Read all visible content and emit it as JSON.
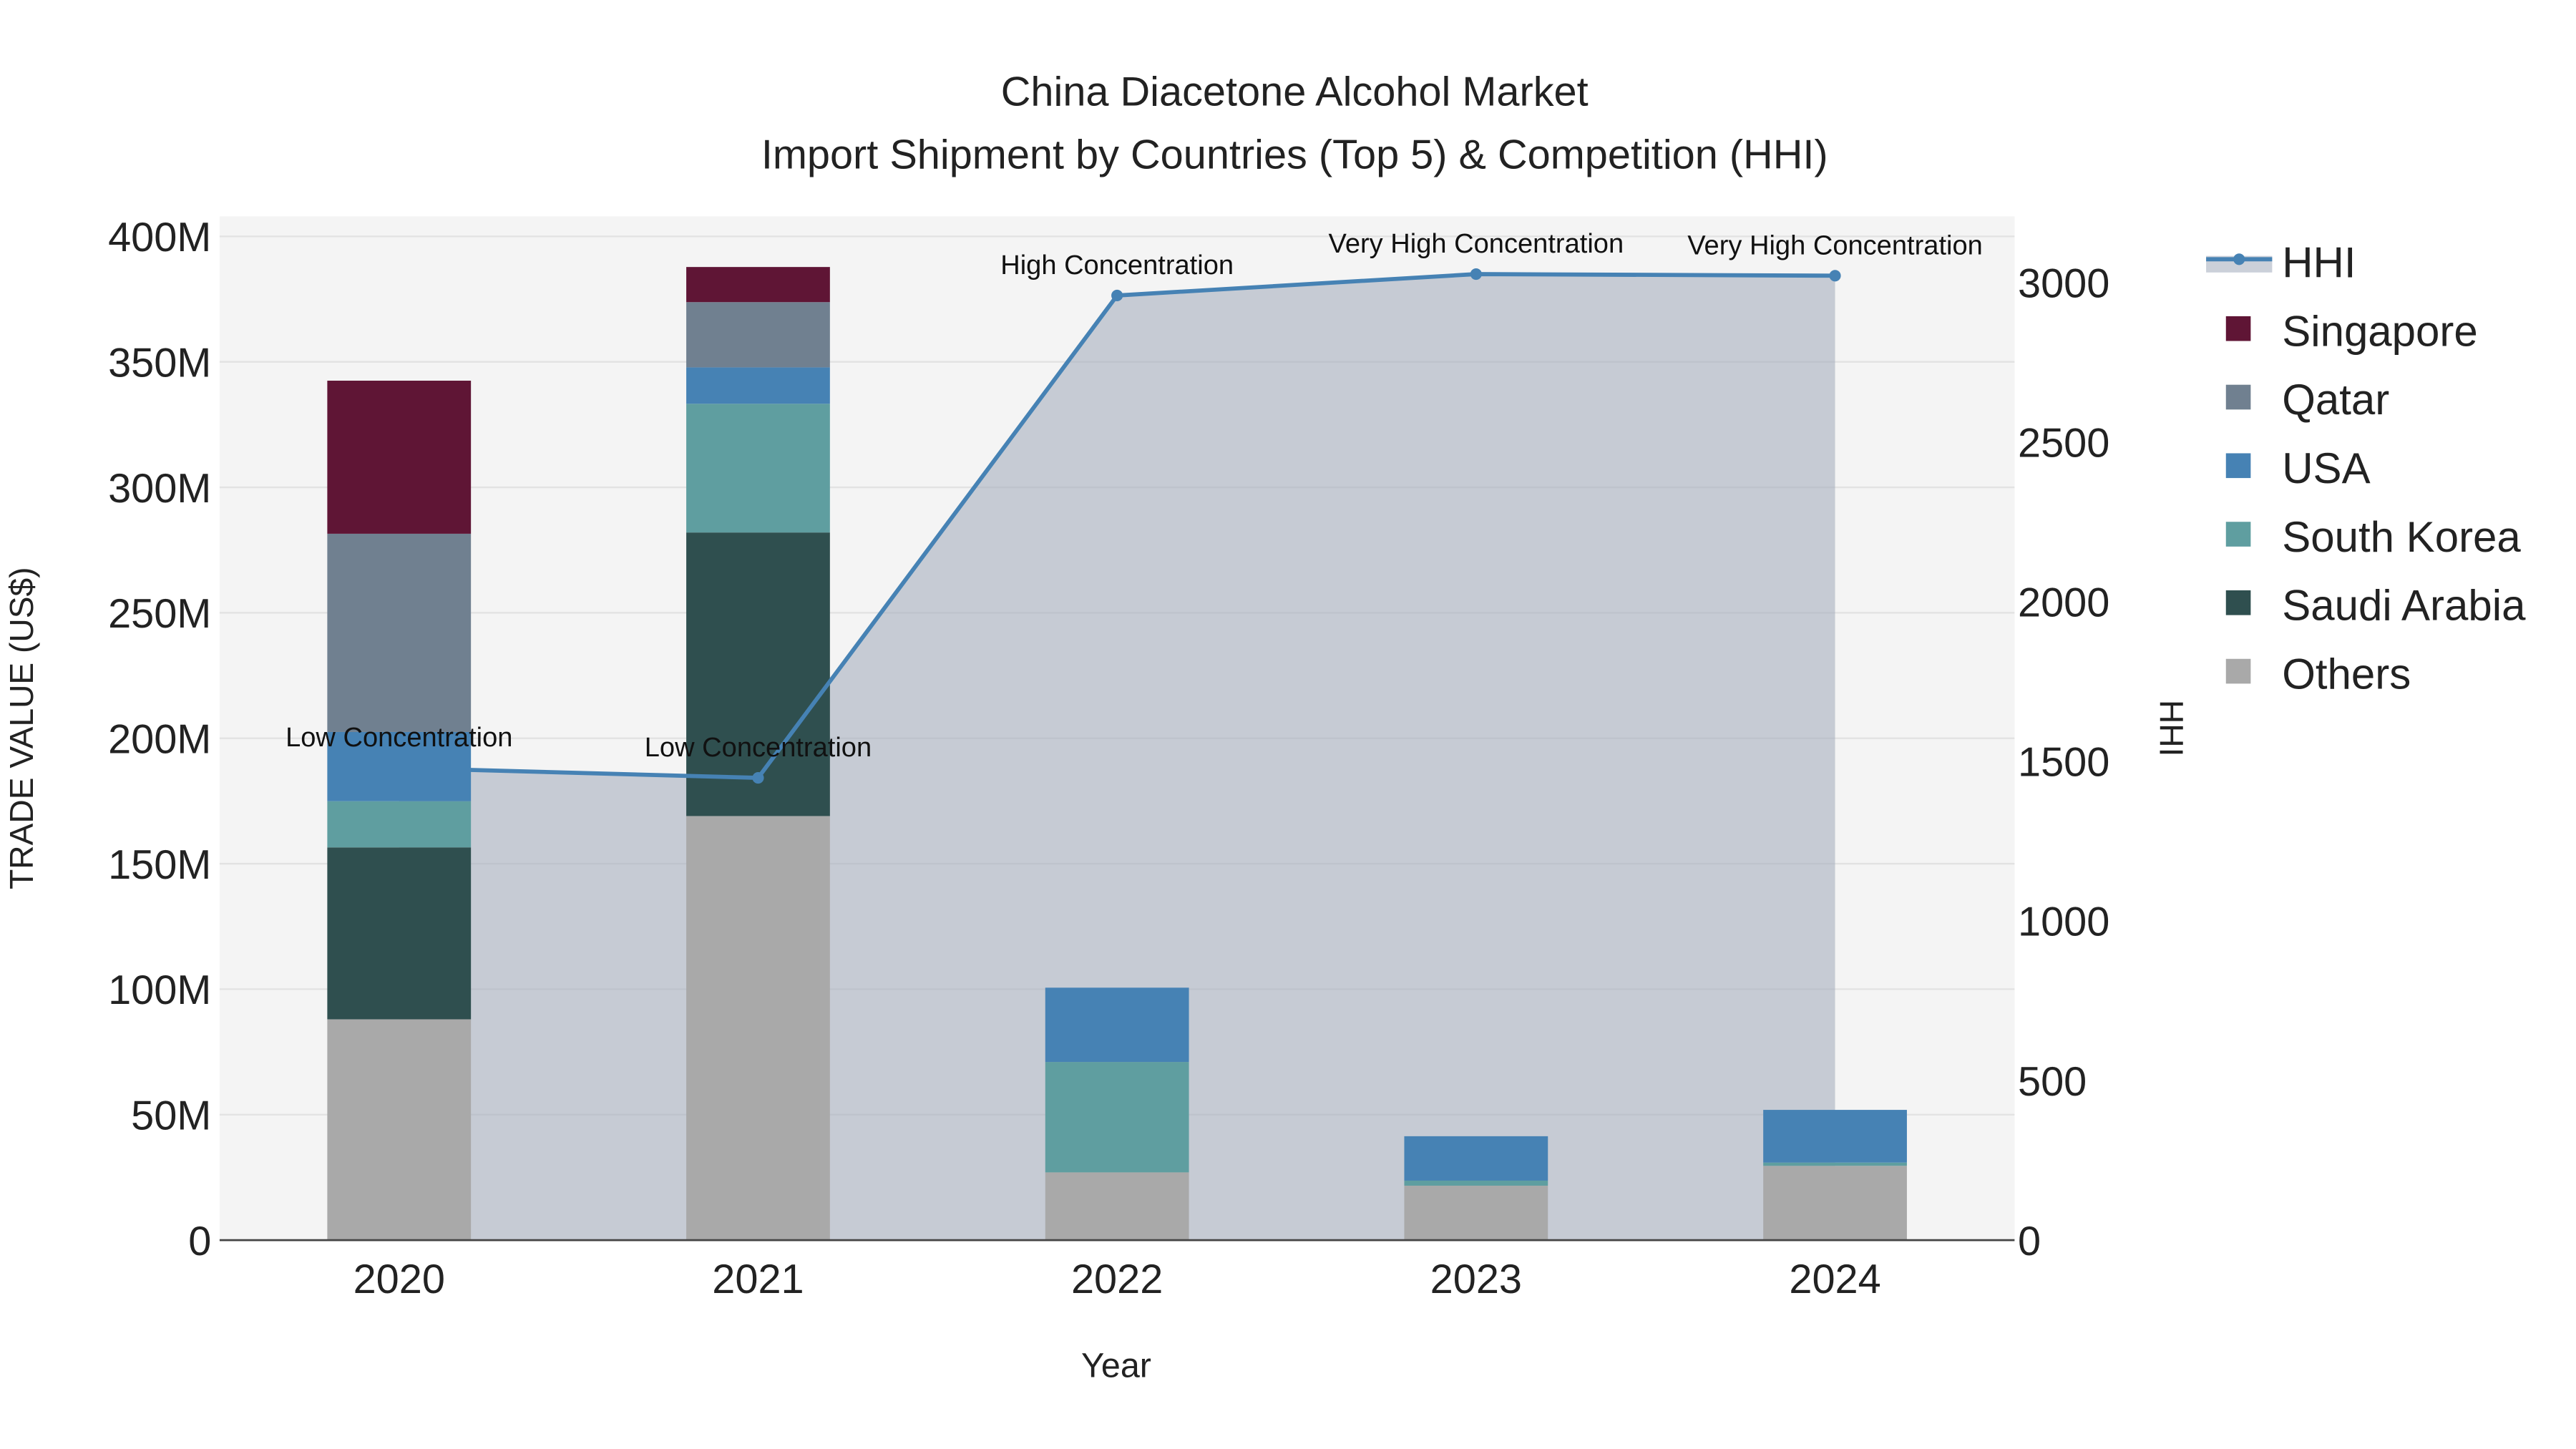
{
  "chart_data": {
    "type": "bar",
    "barmode": "stack",
    "title": "China Diacetone Alcohol Market",
    "subtitle": "Import Shipment by Countries (Top 5) & Competition (HHI)",
    "xlabel": "Year",
    "ylabel": "TRADE VALUE (US$)",
    "y2label": "HHI",
    "categories": [
      "2020",
      "2021",
      "2022",
      "2023",
      "2024"
    ],
    "ylim": [
      0,
      408
    ],
    "y_unit": "M",
    "y_ticks": [
      0,
      50,
      100,
      150,
      200,
      250,
      300,
      350,
      400
    ],
    "y_tick_labels": [
      "0",
      "50M",
      "100M",
      "150M",
      "200M",
      "250M",
      "300M",
      "350M",
      "400M"
    ],
    "y2lim": [
      0,
      3207
    ],
    "y2_ticks": [
      0,
      500,
      1000,
      1500,
      2000,
      2500,
      3000
    ],
    "y2_tick_labels": [
      "0",
      "500",
      "1000",
      "1500",
      "2000",
      "2500",
      "3000"
    ],
    "series": [
      {
        "name": "Others",
        "color": "#a9a9a9",
        "values": [
          88,
          169,
          27,
          21.7,
          29.6
        ]
      },
      {
        "name": "Saudi Arabia",
        "color": "#2f4f4f",
        "values": [
          68.5,
          113,
          0,
          0,
          0
        ]
      },
      {
        "name": "South Korea",
        "color": "#5f9ea0",
        "values": [
          18.4,
          51.3,
          44,
          2,
          1.3
        ]
      },
      {
        "name": "USA",
        "color": "#4682b4",
        "values": [
          27.6,
          14.5,
          29.6,
          17.7,
          21
        ]
      },
      {
        "name": "Qatar",
        "color": "#708090",
        "values": [
          79,
          26,
          0,
          0,
          0
        ]
      },
      {
        "name": "Singapore",
        "color": "#5f1535",
        "values": [
          61,
          14,
          0,
          0,
          0
        ]
      }
    ],
    "line": {
      "name": "HHI",
      "color": "#4682b4",
      "values": [
        1479,
        1448,
        2959,
        3026,
        3021
      ],
      "annotations": [
        "Low Concentration",
        "Low Concentration",
        "High Concentration",
        "Very High Concentration",
        "Very High Concentration"
      ]
    },
    "legend_order": [
      "HHI",
      "Singapore",
      "Qatar",
      "USA",
      "South Korea",
      "Saudi Arabia",
      "Others"
    ],
    "legend_position": "right",
    "grid": true
  }
}
